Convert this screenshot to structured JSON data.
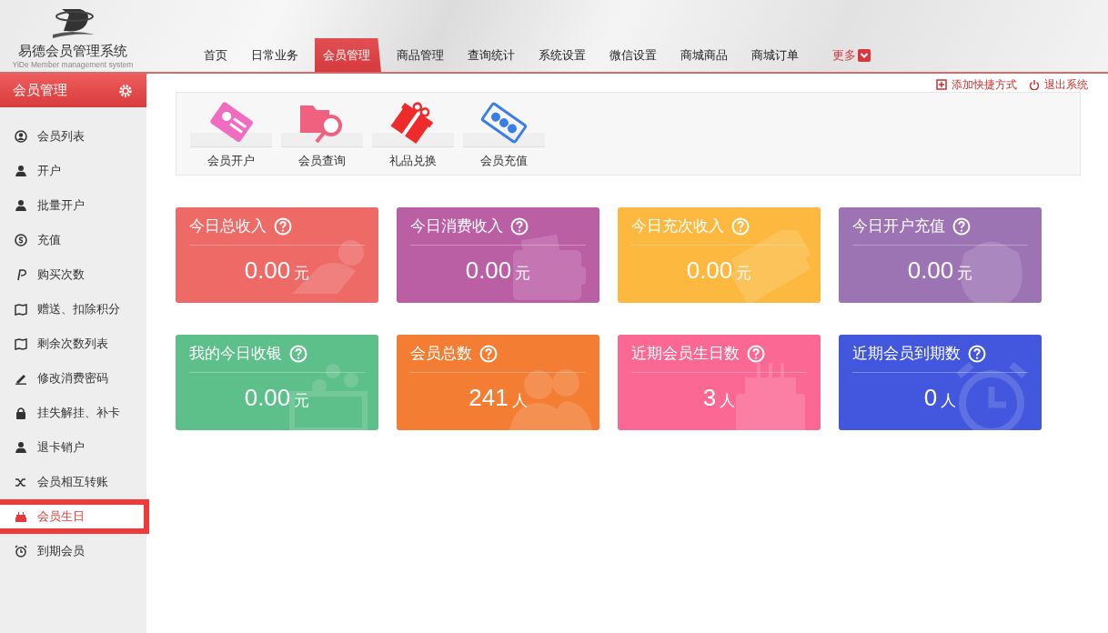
{
  "logo": {
    "title": "易德会员管理系统",
    "subtitle": "YiDe Member management system"
  },
  "nav": [
    {
      "label": "首页",
      "selected": false
    },
    {
      "label": "日常业务",
      "selected": false
    },
    {
      "label": "会员管理",
      "selected": true
    },
    {
      "label": "商品管理",
      "selected": false
    },
    {
      "label": "查询统计",
      "selected": false
    },
    {
      "label": "系统设置",
      "selected": false
    },
    {
      "label": "微信设置",
      "selected": false
    },
    {
      "label": "商城商品",
      "selected": false
    },
    {
      "label": "商城订单",
      "selected": false
    }
  ],
  "more": {
    "label": "更多"
  },
  "top_links": [
    "添加快捷方式",
    "退出系统"
  ],
  "sidebar": {
    "title": "会员管理",
    "items": [
      {
        "label": "会员列表",
        "selected": false
      },
      {
        "label": "开户",
        "selected": false
      },
      {
        "label": "批量开户",
        "selected": false
      },
      {
        "label": "充值",
        "selected": false
      },
      {
        "label": "购买次数",
        "selected": false
      },
      {
        "label": "赠送、扣除积分",
        "selected": false
      },
      {
        "label": "剩余次数列表",
        "selected": false
      },
      {
        "label": "修改消费密码",
        "selected": false
      },
      {
        "label": "挂失解挂、补卡",
        "selected": false
      },
      {
        "label": "退卡销户",
        "selected": false
      },
      {
        "label": "会员相互转账",
        "selected": false
      },
      {
        "label": "会员生日",
        "selected": true
      },
      {
        "label": "到期会员",
        "selected": false
      }
    ]
  },
  "shortcuts": [
    "会员开户",
    "会员查询",
    "礼品兑换",
    "会员充值"
  ],
  "cards": [
    {
      "title": "今日总收入",
      "value": "0.00",
      "unit": "元",
      "color": "#ee6a66"
    },
    {
      "title": "今日消费收入",
      "value": "0.00",
      "unit": "元",
      "color": "#bb5fa5"
    },
    {
      "title": "今日充次收入",
      "value": "0.00",
      "unit": "元",
      "color": "#fdb93f"
    },
    {
      "title": "今日开户充值",
      "value": "0.00",
      "unit": "元",
      "color": "#9c74b4"
    },
    {
      "title": "我的今日收银",
      "value": "0.00",
      "unit": "元",
      "color": "#5dbf89"
    },
    {
      "title": "会员总数",
      "value": "241",
      "unit": "人",
      "color": "#f27d33"
    },
    {
      "title": "近期会员生日数",
      "value": "3",
      "unit": "人",
      "color": "#fb6894"
    },
    {
      "title": "近期会员到期数",
      "value": "0",
      "unit": "人",
      "color": "#4257dd"
    }
  ]
}
